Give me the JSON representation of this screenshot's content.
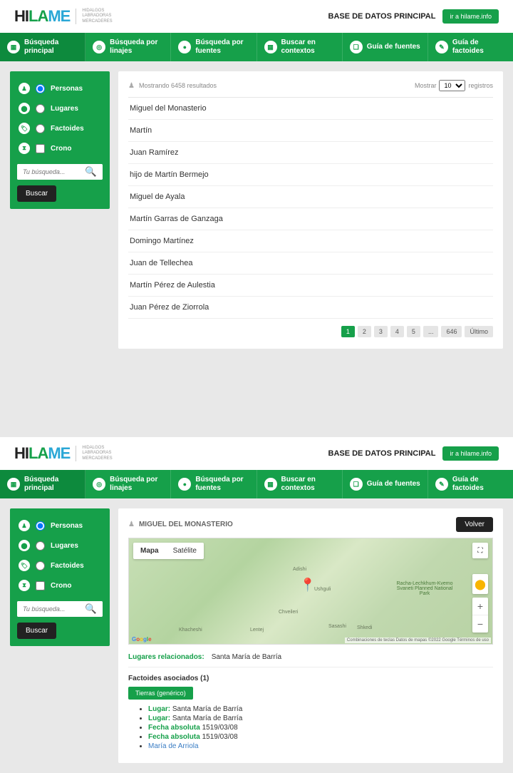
{
  "header": {
    "logo": {
      "hi": "HI",
      "la": "LA",
      "me": "ME",
      "sub1": "HIDALGOS",
      "sub2": "LABRADORAS",
      "sub3": "MERCADERES"
    },
    "db_title": "BASE DE DATOS PRINCIPAL",
    "link_btn": "ir a hilame.info"
  },
  "nav": [
    {
      "label": "Búsqueda principal",
      "icon": "▦"
    },
    {
      "label": "Búsqueda por linajes",
      "icon": "◎"
    },
    {
      "label": "Búsqueda por fuentes",
      "icon": "●"
    },
    {
      "label": "Buscar en contextos",
      "icon": "▦"
    },
    {
      "label": "Guía de fuentes",
      "icon": "❏"
    },
    {
      "label": "Guía de factoides",
      "icon": "✎"
    }
  ],
  "filters": [
    {
      "label": "Personas",
      "icon": "♟",
      "type": "radio",
      "checked": true
    },
    {
      "label": "Lugares",
      "icon": "⬤",
      "type": "radio",
      "checked": false
    },
    {
      "label": "Factoides",
      "icon": "🏷",
      "type": "radio",
      "checked": false
    },
    {
      "label": "Crono",
      "icon": "⧗",
      "type": "checkbox",
      "checked": false
    }
  ],
  "search": {
    "placeholder": "Tu búsqueda...",
    "button": "Buscar"
  },
  "list": {
    "showing": "Mostrando 6458 resultados",
    "show_label": "Mostrar",
    "entries_label": "registros",
    "page_size": "10",
    "rows": [
      "Miguel del Monasterio",
      "Martín",
      "Juan Ramírez",
      "hijo de Martín Bermejo",
      "Miguel de Ayala",
      "Martín Garras de Ganzaga",
      "Domingo Martínez",
      "Juan de Tellechea",
      "Martín Pérez de Aulestia",
      "Juan Pérez de Ziorrola"
    ],
    "pages": [
      "1",
      "2",
      "3",
      "4",
      "5",
      "...",
      "646",
      "Último"
    ]
  },
  "detail": {
    "title": "MIGUEL DEL MONASTERIO",
    "back": "Volver",
    "map_toggle": {
      "map": "Mapa",
      "sat": "Satélite"
    },
    "map_labels": [
      "Adishi",
      "Ushguli",
      "Chveileri",
      "Lentej",
      "Sasashi",
      "Shkedi",
      "Khacheshi",
      "Racha-Lechkhum-Kvemo Svaneti Planned National Park"
    ],
    "map_attr": "Combinaciones de teclas   Datos de mapas ©2022 Google   Términos de uso",
    "places_label": "Lugares relacionados:",
    "places_value": "Santa María de Barría",
    "facts_title": "Factoides asociados (1)",
    "tag": "Tierras (genérico)",
    "facts": [
      {
        "k": "Lugar:",
        "v": "Santa María de Barría"
      },
      {
        "k": "Lugar:",
        "v": "Santa María de Barría"
      },
      {
        "k": "Fecha absoluta",
        "v": "1519/03/08"
      },
      {
        "k": "Fecha absoluta",
        "v": "1519/03/08"
      }
    ],
    "link": "María de Arriola"
  }
}
